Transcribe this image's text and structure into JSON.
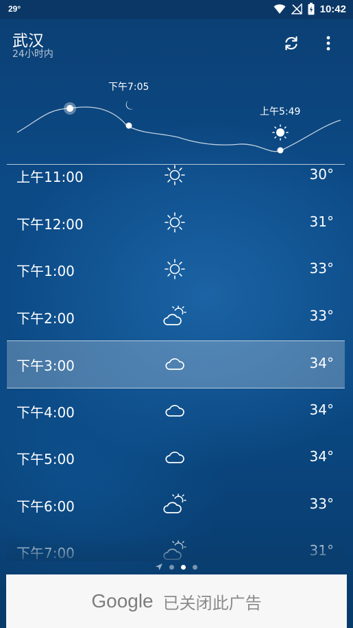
{
  "status_bar": {
    "temperature": "29°",
    "time": "10:42"
  },
  "header": {
    "city": "武汉",
    "subtitle": "24小时内"
  },
  "graph": {
    "moon_time": "下午7:05",
    "sun_time": "上午5:49"
  },
  "hourly": [
    {
      "time": "上午11:00",
      "icon": "sun-icon",
      "temp": "30°"
    },
    {
      "time": "下午12:00",
      "icon": "sun-icon",
      "temp": "31°"
    },
    {
      "time": "下午1:00",
      "icon": "sun-icon",
      "temp": "33°"
    },
    {
      "time": "下午2:00",
      "icon": "partly-cloudy-icon",
      "temp": "33°"
    },
    {
      "time": "下午3:00",
      "icon": "cloud-icon",
      "temp": "34°",
      "selected": true
    },
    {
      "time": "下午4:00",
      "icon": "cloud-icon",
      "temp": "34°"
    },
    {
      "time": "下午5:00",
      "icon": "cloud-icon",
      "temp": "34°"
    },
    {
      "time": "下午6:00",
      "icon": "partly-cloudy-icon",
      "temp": "33°"
    },
    {
      "time": "下午7:00",
      "icon": "partly-cloudy-icon",
      "temp": "31°"
    }
  ],
  "ad": {
    "brand": "Google",
    "message": "已关闭此广告"
  }
}
